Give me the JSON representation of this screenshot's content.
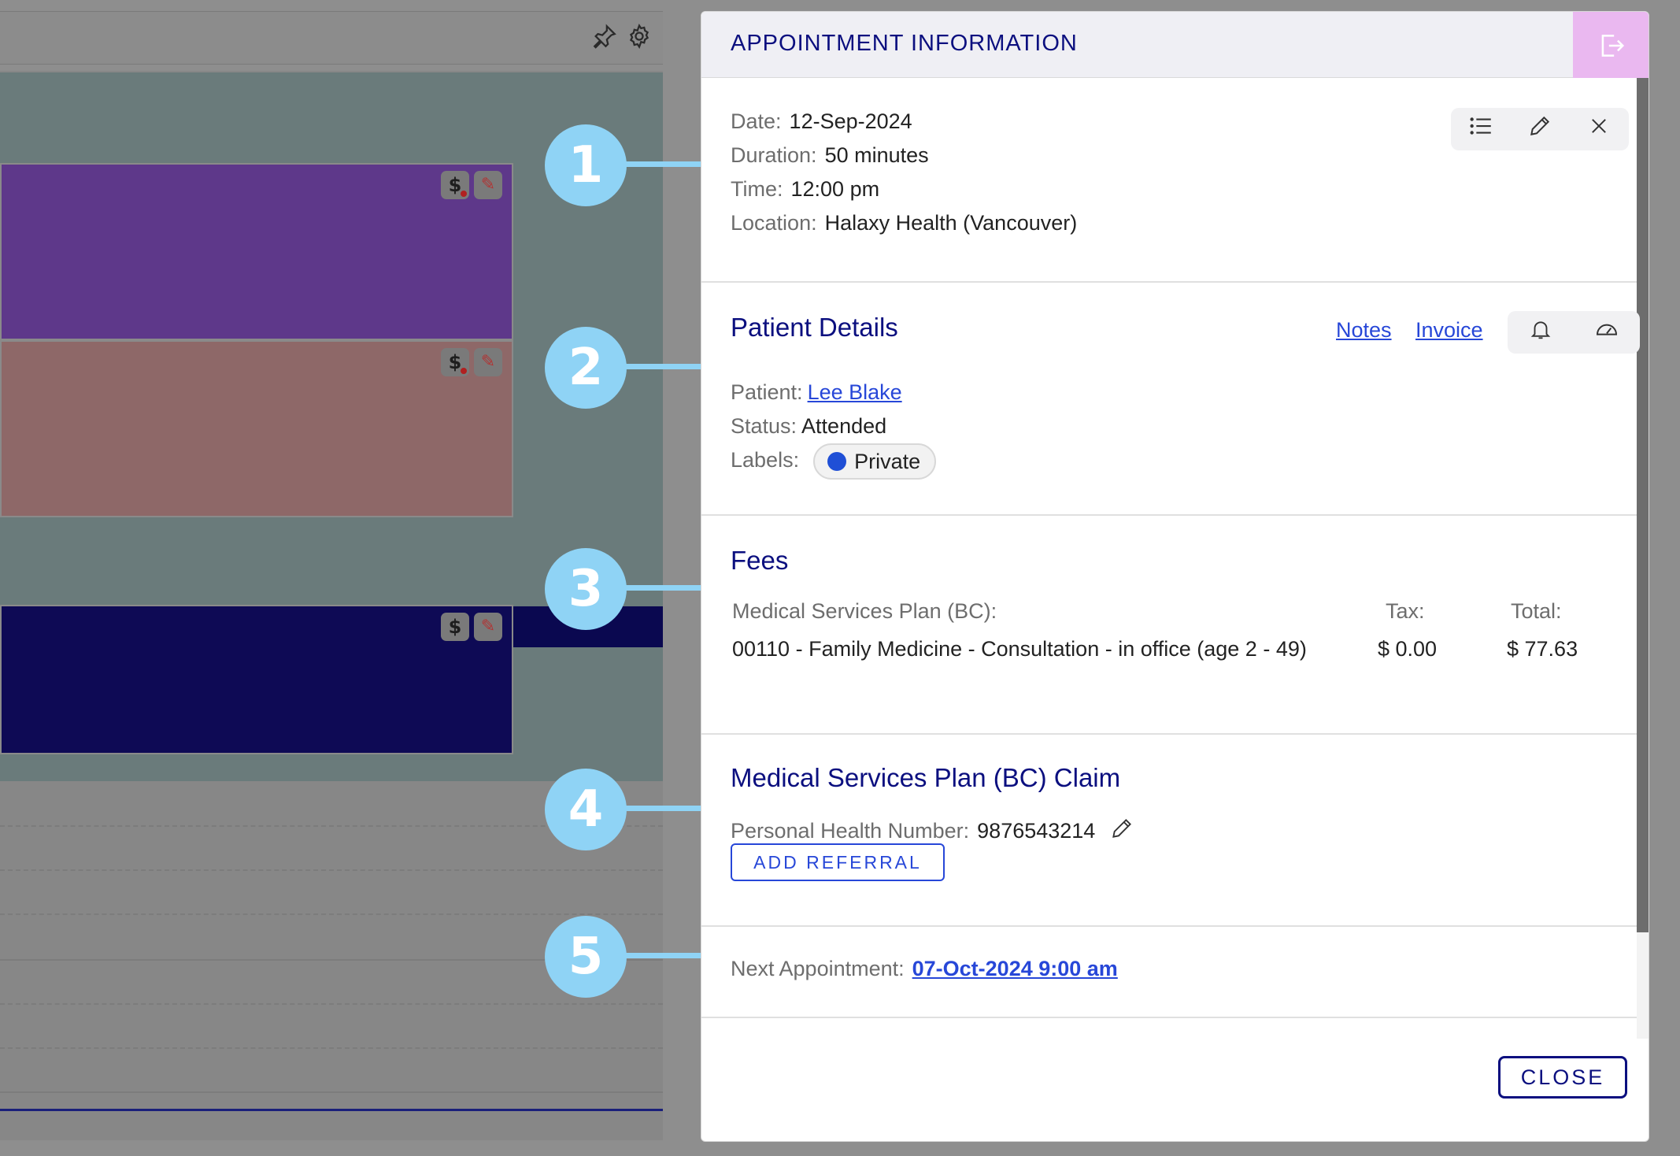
{
  "calendar": {
    "icons": {
      "pin": "pin-icon",
      "settings": "gear-icon",
      "billing": "dollar-icon",
      "edit": "pencil-icon"
    },
    "billing_glyph": "$",
    "appointment_colors": {
      "purple": "#5e388a",
      "rose": "#8e6868",
      "navy": "#0e0a55"
    }
  },
  "callouts": [
    "1",
    "2",
    "3",
    "4",
    "5"
  ],
  "panel": {
    "title": "APPOINTMENT INFORMATION",
    "exit_icon": "exit-icon",
    "appointment": {
      "date_label": "Date:",
      "date_value": "12-Sep-2024",
      "duration_label": "Duration:",
      "duration_value": "50 minutes",
      "time_label": "Time:",
      "time_value": "12:00 pm",
      "location_label": "Location:",
      "location_value": "Halaxy Health (Vancouver)",
      "tools": [
        "list-icon",
        "pencil-icon",
        "close-icon"
      ]
    },
    "patient": {
      "heading": "Patient Details",
      "notes_link": "Notes",
      "invoice_link": "Invoice",
      "tools": [
        "bell-icon",
        "gauge-icon"
      ],
      "patient_label": "Patient:",
      "patient_value": "Lee Blake",
      "status_label": "Status:",
      "status_value": "Attended",
      "labels_label": "Labels:",
      "label_chip": "Private",
      "label_color": "#1f4fd6"
    },
    "fees": {
      "heading": "Fees",
      "plan_label": "Medical Services Plan (BC):",
      "tax_header": "Tax:",
      "total_header": "Total:",
      "item_description": "00110 - Family Medicine - Consultation - in office (age 2 - 49)",
      "item_tax": "$ 0.00",
      "item_total": "$ 77.63"
    },
    "claim": {
      "heading": "Medical Services Plan (BC) Claim",
      "phn_label": "Personal Health Number:",
      "phn_value": "9876543214",
      "add_referral": "ADD REFERRAL"
    },
    "next": {
      "label": "Next Appointment:",
      "value": "07-Oct-2024 9:00 am"
    },
    "close_button": "CLOSE"
  }
}
